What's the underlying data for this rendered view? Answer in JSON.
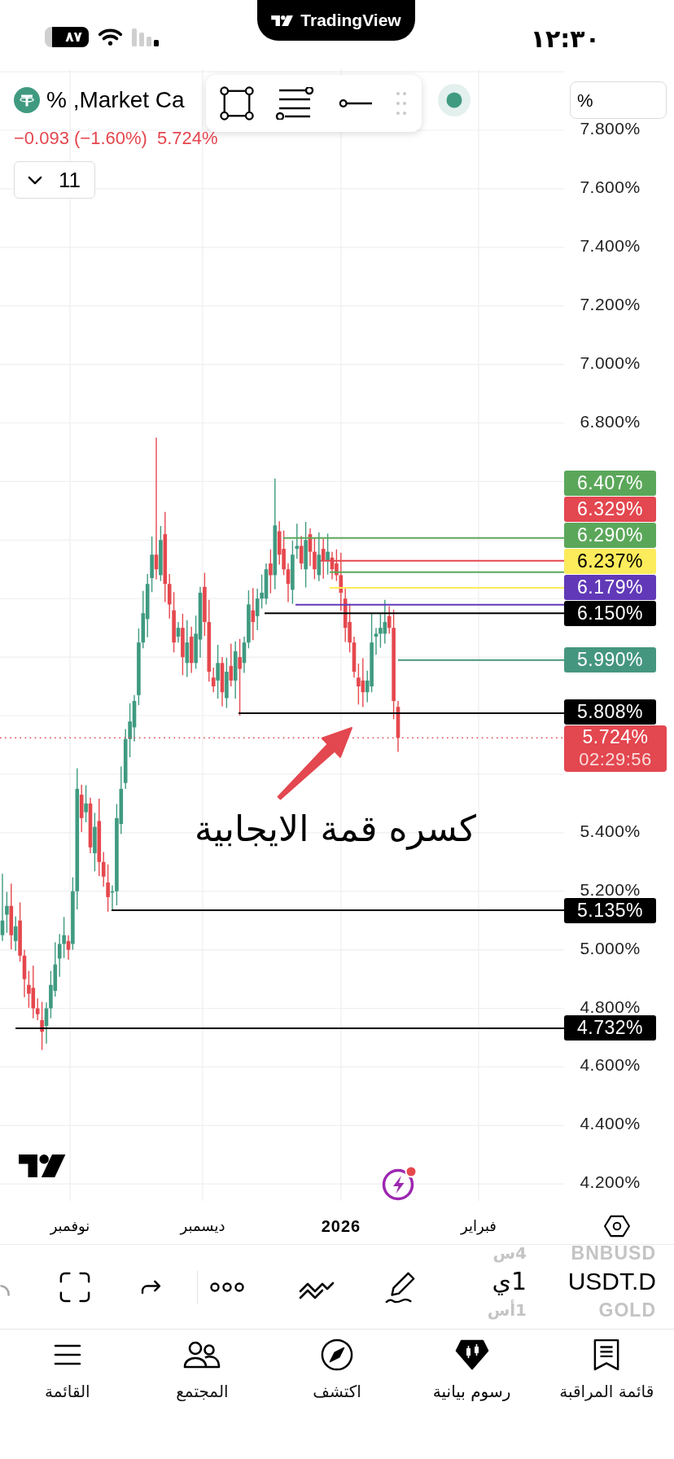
{
  "status_bar": {
    "battery": "٨٧",
    "time": "١٢:٣٠"
  },
  "app_banner": {
    "title": "TradingView"
  },
  "legend": {
    "title": "% ,Market Ca",
    "change": "−0.093 (−1.60%)",
    "price": "5.724%",
    "collapse_button": "11"
  },
  "scale_button": "%",
  "price_axis": {
    "ticks": [
      "7.800%",
      "7.600%",
      "7.400%",
      "7.200%",
      "7.000%",
      "6.800%",
      "5.400%",
      "5.200%",
      "5.000%",
      "4.800%",
      "4.600%",
      "4.400%",
      "4.200%"
    ]
  },
  "price_levels": [
    {
      "label": "6.407%",
      "color": "#5ba75a"
    },
    {
      "label": "6.329%",
      "color": "#e3474f"
    },
    {
      "label": "6.290%",
      "color": "#5ba75a"
    },
    {
      "label": "6.237%",
      "color": "#fceb5b"
    },
    {
      "label": "6.179%",
      "color": "#6139b8"
    },
    {
      "label": "6.150%",
      "color": "#000000"
    },
    {
      "label": "5.990%",
      "color": "#45967f"
    },
    {
      "label": "5.808%",
      "color": "#000000"
    },
    {
      "label": "5.135%",
      "color": "#000000"
    },
    {
      "label": "4.732%",
      "color": "#000000"
    }
  ],
  "current_price": {
    "label": "5.724%",
    "countdown": "02:29:56",
    "color": "#e3474f"
  },
  "annotation": {
    "text": "كسره قمة الايجابية"
  },
  "time_axis": [
    {
      "text": "فبراير",
      "kind": "month"
    },
    {
      "text": "2026",
      "kind": "year"
    },
    {
      "text": "ديسمبر",
      "kind": "month"
    },
    {
      "text": "نوفمبر",
      "kind": "month"
    }
  ],
  "symbol_picker": [
    {
      "text": "BNBUSD",
      "selected": false
    },
    {
      "text": "USDT.D",
      "selected": true
    },
    {
      "text": "GOLD",
      "selected": false
    }
  ],
  "interval_picker": [
    {
      "text": "4س",
      "selected": false
    },
    {
      "text": "1ي",
      "selected": true
    },
    {
      "text": "1أس",
      "selected": false
    }
  ],
  "bottom_nav": [
    {
      "label": "قائمة المراقبة",
      "selected": false
    },
    {
      "label": "رسوم بيانية",
      "selected": true
    },
    {
      "label": "اكتشف",
      "selected": false
    },
    {
      "label": "المجتمع",
      "selected": false
    },
    {
      "label": "القائمة",
      "selected": false
    }
  ]
}
